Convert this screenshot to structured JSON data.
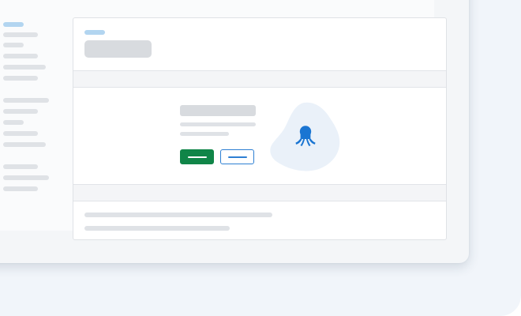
{
  "icons": {
    "mascot": "octopus-icon",
    "primary_action": "dash-icon",
    "secondary_action": "dash-icon"
  },
  "colors": {
    "backdrop": "#f1f5fa",
    "window": "#f4f6f8",
    "inner": "#fafbfc",
    "panel": "#ffffff",
    "band": "#f4f5f7",
    "placeholder": "#dfe2e6",
    "placeholder_strong": "#d8dbdf",
    "accent_light": "#b2d5f0",
    "brand_blue": "#2d7fd3",
    "octopus_blue": "#1a75d2",
    "blob": "#eaf1f9",
    "primary_green": "#108548"
  }
}
